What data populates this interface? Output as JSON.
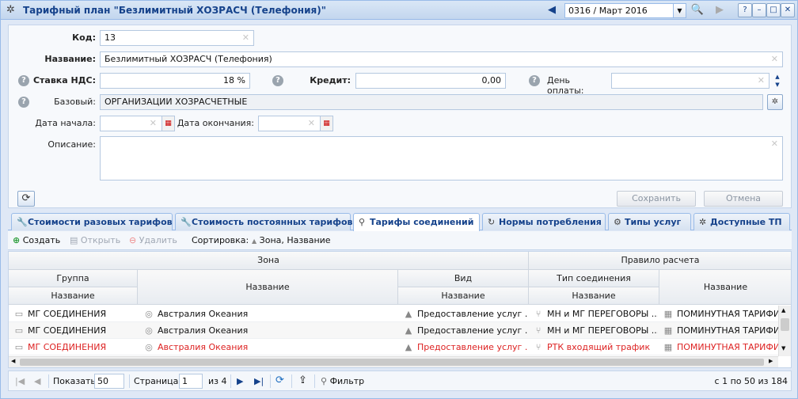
{
  "window": {
    "title": "Тарифный план \"Безлимитный ХОЗРАСЧ (Телефония)\"",
    "period": "0316 / Март 2016",
    "help_label": "?"
  },
  "form": {
    "code_label": "Код:",
    "code_value": "13",
    "name_label": "Название:",
    "name_value": "Безлимитный ХОЗРАСЧ (Телефония)",
    "vat_label": "Ставка НДС:",
    "vat_value": "18 %",
    "credit_label": "Кредит:",
    "credit_value": "0,00",
    "payday_label": "День оплаты:",
    "payday_value": "",
    "base_label": "Базовый:",
    "base_value": "ОРГАНИЗАЦИИ ХОЗРАСЧЕТНЫЕ",
    "start_label": "Дата начала:",
    "start_value": "",
    "end_label": "Дата окончания:",
    "end_value": "",
    "desc_label": "Описание:",
    "desc_value": "",
    "save_label": "Сохранить",
    "cancel_label": "Отмена"
  },
  "tabs": [
    {
      "label": "Стоимости разовых тарифов"
    },
    {
      "label": "Стоимость постоянных тарифов"
    },
    {
      "label": "Тарифы соединений"
    },
    {
      "label": "Нормы потребления"
    },
    {
      "label": "Типы услуг"
    },
    {
      "label": "Доступные ТП"
    }
  ],
  "toolbar": {
    "create": "Создать",
    "open": "Открыть",
    "delete": "Удалить",
    "sort_label": "Сортировка:",
    "sort_value": "Зона, Название"
  },
  "grid": {
    "header_zone": "Зона",
    "header_rule": "Правило расчета",
    "header_group": "Группа",
    "header_name": "Название",
    "header_kind": "Вид",
    "header_conn_type": "Тип соединения",
    "sub_name": "Название",
    "rows": [
      {
        "group": "МГ СОЕДИНЕНИЯ",
        "zone": "Австралия Океания",
        "kind": "Предоставление услуг ...",
        "conn": "МН и МГ ПЕРЕГОВОРЫ ...",
        "rule": "ПОМИНУТНАЯ ТАРИФИ..."
      },
      {
        "group": "МГ СОЕДИНЕНИЯ",
        "zone": "Австралия Океания",
        "kind": "Предоставление услуг ...",
        "conn": "МН и МГ ПЕРЕГОВОРЫ ...",
        "rule": "ПОМИНУТНАЯ ТАРИФИ..."
      },
      {
        "group": "МГ СОЕДИНЕНИЯ",
        "zone": "Австралия Океания",
        "kind": "Предоставление услуг ...",
        "conn": "РТК входящий трафик",
        "rule": "ПОМИНУТНАЯ ТАРИФИ..."
      }
    ]
  },
  "pager": {
    "show_label": "Показать",
    "page_size": "50",
    "page_label": "Страница",
    "page": "1",
    "of_label": "из 4",
    "filter_label": "Фильтр",
    "summary": "с 1 по 50 из 184"
  }
}
